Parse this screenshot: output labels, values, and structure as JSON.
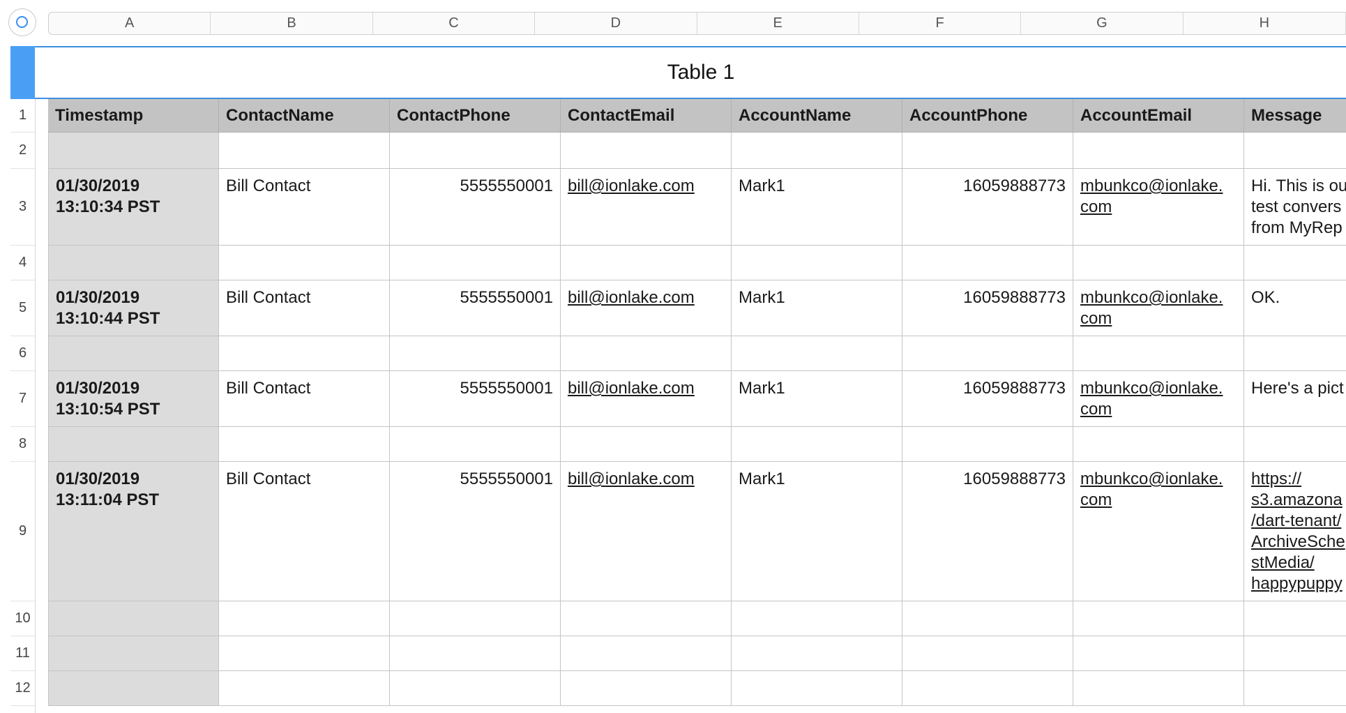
{
  "columns": [
    "A",
    "B",
    "C",
    "D",
    "E",
    "F",
    "G",
    "H"
  ],
  "table": {
    "title": "Table 1",
    "headers": [
      "Timestamp",
      "ContactName",
      "ContactPhone",
      "ContactEmail",
      "AccountName",
      "AccountPhone",
      "AccountEmail",
      "Message"
    ],
    "row_numbers": [
      "1",
      "2",
      "3",
      "4",
      "5",
      "6",
      "7",
      "8",
      "9",
      "10",
      "11",
      "12"
    ],
    "rows": [
      {
        "row": "3",
        "timestamp_date": "01/30/2019",
        "timestamp_time": "13:10:34 PST",
        "contact_name": "Bill Contact",
        "contact_phone": "5555550001",
        "contact_email": "bill@ionlake.com",
        "account_name": "Mark1",
        "account_phone": "16059888773",
        "account_email_1": "mbunkco@ionlake.",
        "account_email_2": "com",
        "message": [
          "Hi. This is ou",
          "test convers",
          "from MyRep"
        ]
      },
      {
        "row": "5",
        "timestamp_date": "01/30/2019",
        "timestamp_time": "13:10:44 PST",
        "contact_name": "Bill Contact",
        "contact_phone": "5555550001",
        "contact_email": "bill@ionlake.com",
        "account_name": "Mark1",
        "account_phone": "16059888773",
        "account_email_1": "mbunkco@ionlake.",
        "account_email_2": "com",
        "message": [
          "OK."
        ]
      },
      {
        "row": "7",
        "timestamp_date": "01/30/2019",
        "timestamp_time": "13:10:54 PST",
        "contact_name": "Bill Contact",
        "contact_phone": "5555550001",
        "contact_email": "bill@ionlake.com",
        "account_name": "Mark1",
        "account_phone": "16059888773",
        "account_email_1": "mbunkco@ionlake.",
        "account_email_2": "com",
        "message": [
          "Here's a pict"
        ]
      },
      {
        "row": "9",
        "timestamp_date": "01/30/2019",
        "timestamp_time": "13:11:04 PST",
        "contact_name": "Bill Contact",
        "contact_phone": "5555550001",
        "contact_email": "bill@ionlake.com",
        "account_name": "Mark1",
        "account_phone": "16059888773",
        "account_email_1": "mbunkco@ionlake.",
        "account_email_2": "com",
        "message": [
          "https://",
          "s3.amazona",
          "/dart-tenant/",
          "ArchiveSche",
          "stMedia/",
          "happypuppy"
        ]
      }
    ]
  },
  "colors": {
    "accent": "#4a9ff5",
    "header_bg": "#c3c3c3",
    "timestamp_bg": "#dcdcdc"
  }
}
